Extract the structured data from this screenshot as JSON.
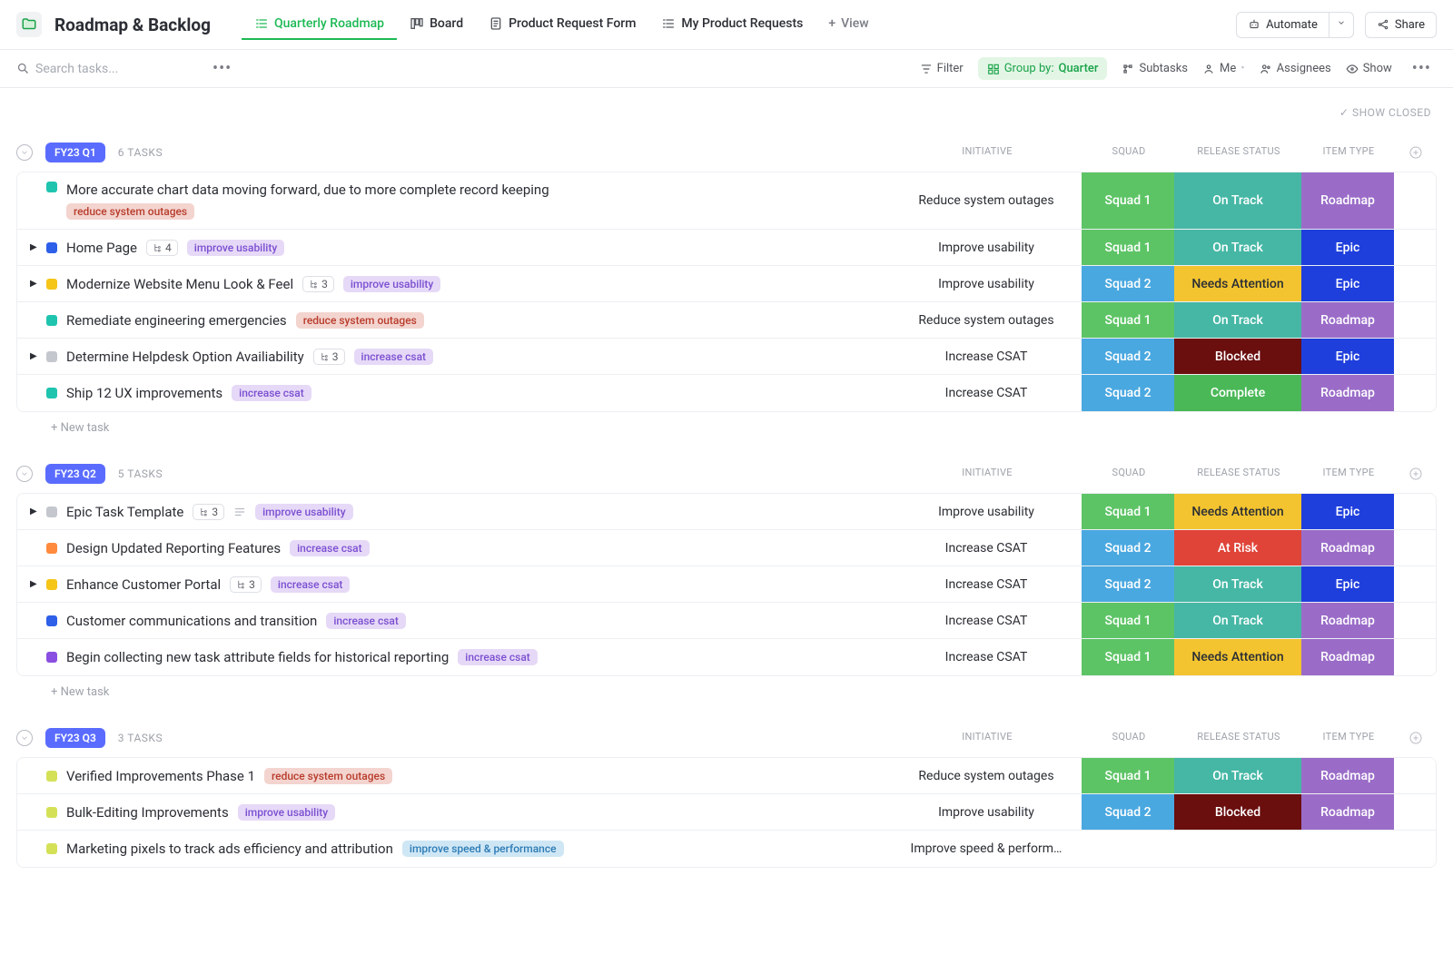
{
  "header": {
    "title": "Roadmap & Backlog",
    "tabs": [
      {
        "label": "Quarterly Roadmap",
        "active": true
      },
      {
        "label": "Board"
      },
      {
        "label": "Product Request Form"
      },
      {
        "label": "My Product Requests"
      }
    ],
    "add_view": "View",
    "automate": "Automate",
    "share": "Share"
  },
  "toolbar": {
    "search_placeholder": "Search tasks...",
    "filter": "Filter",
    "group_by_label": "Group by:",
    "group_by_value": "Quarter",
    "subtasks": "Subtasks",
    "me": "Me",
    "assignees": "Assignees",
    "show": "Show"
  },
  "show_closed": "SHOW CLOSED",
  "new_task_label": "+ New task",
  "column_headers": {
    "initiative": "INITIATIVE",
    "squad": "SQUAD",
    "release_status": "RELEASE STATUS",
    "item_type": "ITEM TYPE"
  },
  "groups": [
    {
      "chip": "FY23 Q1",
      "count": "6 TASKS",
      "tasks": [
        {
          "expand": false,
          "status_color": "sq-teal",
          "multiline": true,
          "name": "More accurate chart data moving forward, due to more complete record keeping",
          "tags": [
            [
              "reduce system outages",
              "tag-red"
            ]
          ],
          "initiative": "Reduce system outages",
          "squad": [
            "Squad 1",
            "bg-green"
          ],
          "release": [
            "On Track",
            "bg-teal"
          ],
          "item": [
            "Roadmap",
            "bg-purple"
          ]
        },
        {
          "expand": true,
          "status_color": "sq-blue",
          "name": "Home Page",
          "sub": "4",
          "tags": [
            [
              "improve usability",
              "tag-purple"
            ]
          ],
          "initiative": "Improve usability",
          "squad": [
            "Squad 1",
            "bg-green"
          ],
          "release": [
            "On Track",
            "bg-teal"
          ],
          "item": [
            "Epic",
            "bg-blueDark"
          ]
        },
        {
          "expand": true,
          "status_color": "sq-yellow",
          "name": "Modernize Website Menu Look & Feel",
          "sub": "3",
          "tags": [
            [
              "improve usability",
              "tag-purple"
            ]
          ],
          "initiative": "Improve usability",
          "squad": [
            "Squad 2",
            "bg-skyBlue"
          ],
          "release": [
            "Needs Attention",
            "bg-amber"
          ],
          "item": [
            "Epic",
            "bg-blueDark"
          ]
        },
        {
          "expand": false,
          "status_color": "sq-teal",
          "name": "Remediate engineering emergencies",
          "tags": [
            [
              "reduce system outages",
              "tag-red"
            ]
          ],
          "initiative": "Reduce system outages",
          "squad": [
            "Squad 1",
            "bg-green"
          ],
          "release": [
            "On Track",
            "bg-teal"
          ],
          "item": [
            "Roadmap",
            "bg-purple"
          ]
        },
        {
          "expand": true,
          "status_color": "sq-grey",
          "name": "Determine Helpdesk Option Availiability",
          "sub": "3",
          "tags": [
            [
              "increase csat",
              "tag-purple"
            ]
          ],
          "initiative": "Increase CSAT",
          "squad": [
            "Squad 2",
            "bg-skyBlue"
          ],
          "release": [
            "Blocked",
            "bg-darkRed"
          ],
          "item": [
            "Epic",
            "bg-blueDark"
          ]
        },
        {
          "expand": false,
          "status_color": "sq-teal",
          "name": "Ship 12 UX improvements",
          "tags": [
            [
              "increase csat",
              "tag-purple"
            ]
          ],
          "initiative": "Increase CSAT",
          "squad": [
            "Squad 2",
            "bg-skyBlue"
          ],
          "release": [
            "Complete",
            "bg-brightGreen"
          ],
          "item": [
            "Roadmap",
            "bg-purple"
          ]
        }
      ]
    },
    {
      "chip": "FY23 Q2",
      "count": "5 TASKS",
      "tasks": [
        {
          "expand": true,
          "status_color": "sq-grey",
          "name": "Epic Task Template",
          "sub": "3",
          "desc": true,
          "tags": [
            [
              "improve usability",
              "tag-purple"
            ]
          ],
          "initiative": "Improve usability",
          "squad": [
            "Squad 1",
            "bg-green"
          ],
          "release": [
            "Needs Attention",
            "bg-amber"
          ],
          "item": [
            "Epic",
            "bg-blueDark"
          ]
        },
        {
          "expand": false,
          "status_color": "sq-orange",
          "name": "Design Updated Reporting Features",
          "tags": [
            [
              "increase csat",
              "tag-purple"
            ]
          ],
          "initiative": "Increase CSAT",
          "squad": [
            "Squad 2",
            "bg-skyBlue"
          ],
          "release": [
            "At Risk",
            "bg-red"
          ],
          "item": [
            "Roadmap",
            "bg-purple"
          ]
        },
        {
          "expand": true,
          "status_color": "sq-yellow",
          "name": "Enhance Customer Portal",
          "sub": "3",
          "tags": [
            [
              "increase csat",
              "tag-purple"
            ]
          ],
          "initiative": "Increase CSAT",
          "squad": [
            "Squad 2",
            "bg-skyBlue"
          ],
          "release": [
            "On Track",
            "bg-teal"
          ],
          "item": [
            "Epic",
            "bg-blueDark"
          ]
        },
        {
          "expand": false,
          "status_color": "sq-blue",
          "name": "Customer communications and transition",
          "tags": [
            [
              "increase csat",
              "tag-purple"
            ]
          ],
          "initiative": "Increase CSAT",
          "squad": [
            "Squad 1",
            "bg-green"
          ],
          "release": [
            "On Track",
            "bg-teal"
          ],
          "item": [
            "Roadmap",
            "bg-purple"
          ]
        },
        {
          "expand": false,
          "status_color": "sq-purple",
          "name": "Begin collecting new task attribute fields for historical reporting",
          "tags": [
            [
              "increase csat",
              "tag-purple"
            ]
          ],
          "initiative": "Increase CSAT",
          "squad": [
            "Squad 1",
            "bg-green"
          ],
          "release": [
            "Needs Attention",
            "bg-amber"
          ],
          "item": [
            "Roadmap",
            "bg-purple"
          ]
        }
      ]
    },
    {
      "chip": "FY23 Q3",
      "count": "3 TASKS",
      "tasks": [
        {
          "expand": false,
          "status_color": "sq-lime",
          "name": "Verified Improvements Phase 1",
          "tags": [
            [
              "reduce system outages",
              "tag-red"
            ]
          ],
          "initiative": "Reduce system outages",
          "squad": [
            "Squad 1",
            "bg-green"
          ],
          "release": [
            "On Track",
            "bg-teal"
          ],
          "item": [
            "Roadmap",
            "bg-purple"
          ]
        },
        {
          "expand": false,
          "status_color": "sq-lime",
          "name": "Bulk-Editing Improvements",
          "tags": [
            [
              "improve usability",
              "tag-purple"
            ]
          ],
          "initiative": "Improve usability",
          "squad": [
            "Squad 2",
            "bg-skyBlue"
          ],
          "release": [
            "Blocked",
            "bg-darkRed"
          ],
          "item": [
            "Roadmap",
            "bg-purple"
          ]
        },
        {
          "expand": false,
          "status_color": "sq-lime",
          "name": "Marketing pixels to track ads efficiency and attribution",
          "tags": [
            [
              "improve speed & performance",
              "tag-blue"
            ]
          ],
          "initiative": "Improve speed & perform…",
          "squad": [
            "",
            "bg"
          ],
          "release": [
            "",
            "bg"
          ],
          "item": [
            "",
            "bg"
          ]
        }
      ]
    }
  ]
}
